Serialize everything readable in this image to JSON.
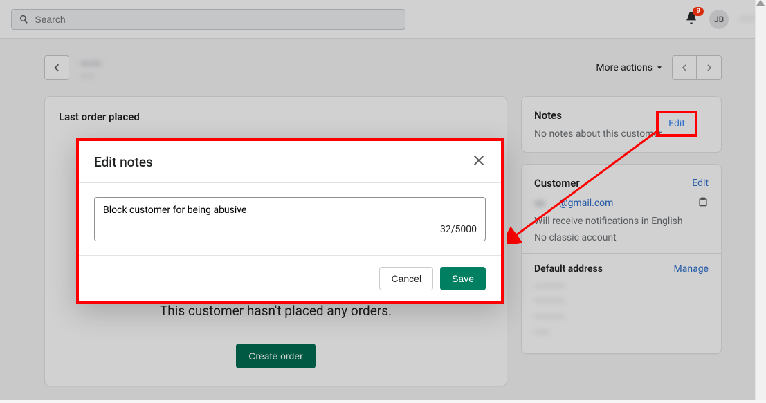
{
  "search": {
    "placeholder": "Search"
  },
  "topbar": {
    "badge": "9",
    "avatar_initials": "JB",
    "username": "——"
  },
  "header": {
    "title": "——",
    "subtitle": "——",
    "more_actions": "More actions"
  },
  "last_order": {
    "heading": "Last order placed",
    "empty_msg": "This customer hasn't placed any orders.",
    "create_btn": "Create order"
  },
  "notes_card": {
    "heading": "Notes",
    "edit": "Edit",
    "empty": "No notes about this customer"
  },
  "customer_card": {
    "heading": "Customer",
    "edit": "Edit",
    "email_suffix": "@gmail.com",
    "notif_line": "Will receive notifications in English",
    "classic_line": "No classic account",
    "default_addr": "Default address",
    "manage": "Manage"
  },
  "modal": {
    "title": "Edit notes",
    "note_text": "Block customer for being abusive",
    "counter": "32/5000",
    "cancel": "Cancel",
    "save": "Save"
  }
}
